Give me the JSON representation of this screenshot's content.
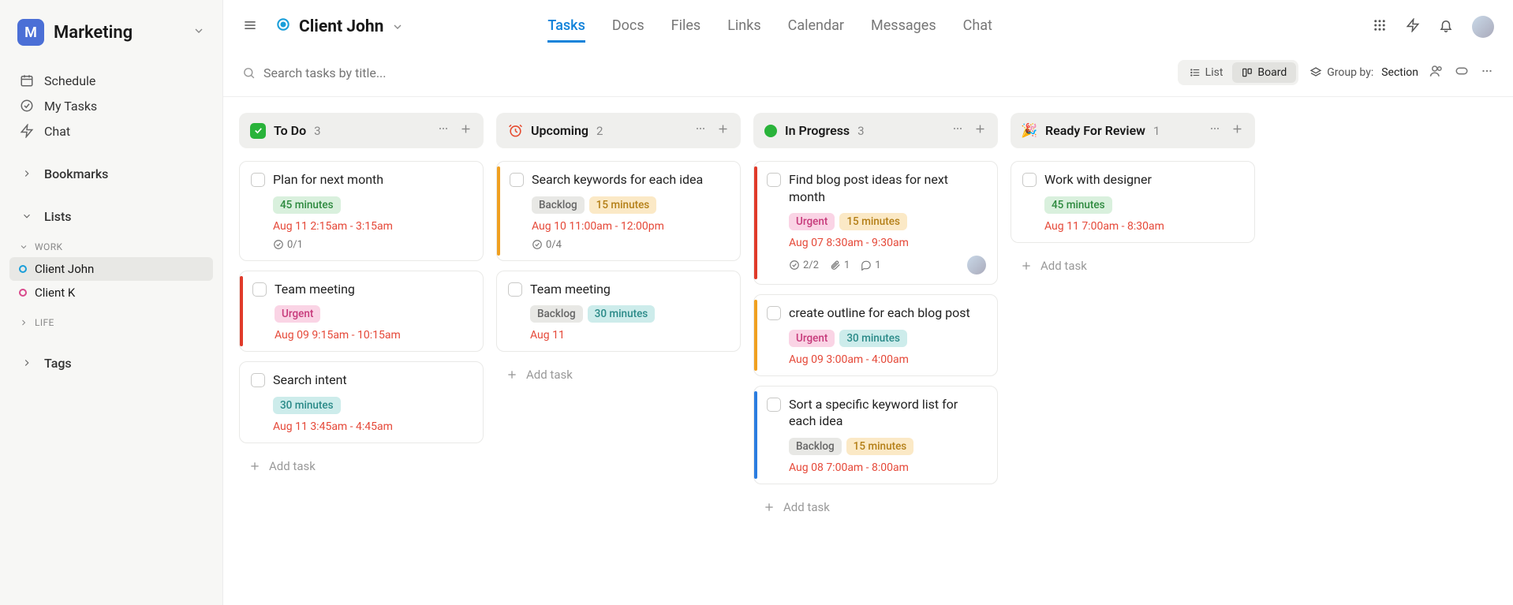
{
  "workspace": {
    "badge": "M",
    "name": "Marketing"
  },
  "sidebar": {
    "nav": [
      {
        "label": "Schedule"
      },
      {
        "label": "My Tasks"
      },
      {
        "label": "Chat"
      }
    ],
    "bookmarks": "Bookmarks",
    "lists_label": "Lists",
    "groups": [
      {
        "name": "WORK",
        "items": [
          {
            "label": "Client John",
            "color": "#1a9ed9",
            "active": true
          },
          {
            "label": "Client K",
            "color": "#d94a8c",
            "active": false
          }
        ]
      },
      {
        "name": "LIFE",
        "items": []
      }
    ],
    "tags": "Tags"
  },
  "header": {
    "project": "Client John",
    "tabs": [
      "Tasks",
      "Docs",
      "Files",
      "Links",
      "Calendar",
      "Messages",
      "Chat"
    ],
    "active_tab": 0
  },
  "toolbar": {
    "search_placeholder": "Search tasks by title...",
    "view_list": "List",
    "view_board": "Board",
    "groupby_label": "Group by:",
    "groupby_value": "Section"
  },
  "columns": [
    {
      "title": "To Do",
      "count": "3",
      "icon": "todo",
      "cards": [
        {
          "title": "Plan for next month",
          "chips": [
            {
              "t": "45 minutes",
              "c": "green"
            }
          ],
          "date": "Aug 11 2:15am - 3:15am",
          "sub": "0/1",
          "stripe": null
        },
        {
          "title": "Team meeting",
          "chips": [
            {
              "t": "Urgent",
              "c": "pink"
            }
          ],
          "date": "Aug 09 9:15am - 10:15am",
          "stripe": "#e03a2a"
        },
        {
          "title": "Search intent",
          "chips": [
            {
              "t": "30 minutes",
              "c": "teal"
            }
          ],
          "date": "Aug 11 3:45am - 4:45am",
          "stripe": null
        }
      ]
    },
    {
      "title": "Upcoming",
      "count": "2",
      "icon": "upcoming",
      "cards": [
        {
          "title": "Search keywords for each idea",
          "chips": [
            {
              "t": "Backlog",
              "c": "gray"
            },
            {
              "t": "15 minutes",
              "c": "yellow"
            }
          ],
          "date": "Aug 10 11:00am - 12:00pm",
          "sub": "0/4",
          "stripe": "#f0a020"
        },
        {
          "title": "Team meeting",
          "chips": [
            {
              "t": "Backlog",
              "c": "gray"
            },
            {
              "t": "30 minutes",
              "c": "teal"
            }
          ],
          "date": "Aug 11",
          "stripe": null
        }
      ]
    },
    {
      "title": "In Progress",
      "count": "3",
      "icon": "progress",
      "cards": [
        {
          "title": "Find blog post ideas for next month",
          "chips": [
            {
              "t": "Urgent",
              "c": "pink"
            },
            {
              "t": "15 minutes",
              "c": "yellow"
            }
          ],
          "date": "Aug 07 8:30am - 9:30am",
          "sub": "2/2",
          "attach": "1",
          "comment": "1",
          "avatar": true,
          "stripe": "#e03a2a"
        },
        {
          "title": "create outline for each blog post",
          "chips": [
            {
              "t": "Urgent",
              "c": "pink"
            },
            {
              "t": "30 minutes",
              "c": "teal"
            }
          ],
          "date": "Aug 09 3:00am - 4:00am",
          "stripe": "#f0a020"
        },
        {
          "title": "Sort a specific keyword list for each idea",
          "chips": [
            {
              "t": "Backlog",
              "c": "gray"
            },
            {
              "t": "15 minutes",
              "c": "yellow"
            }
          ],
          "date": "Aug 08 7:00am - 8:00am",
          "stripe": "#2b7de0"
        }
      ]
    },
    {
      "title": "Ready For Review",
      "count": "1",
      "icon": "review",
      "cards": [
        {
          "title": "Work with designer",
          "chips": [
            {
              "t": "45 minutes",
              "c": "green"
            }
          ],
          "date": "Aug 11 7:00am - 8:30am",
          "stripe": null
        }
      ]
    }
  ],
  "add_task_label": "Add task"
}
